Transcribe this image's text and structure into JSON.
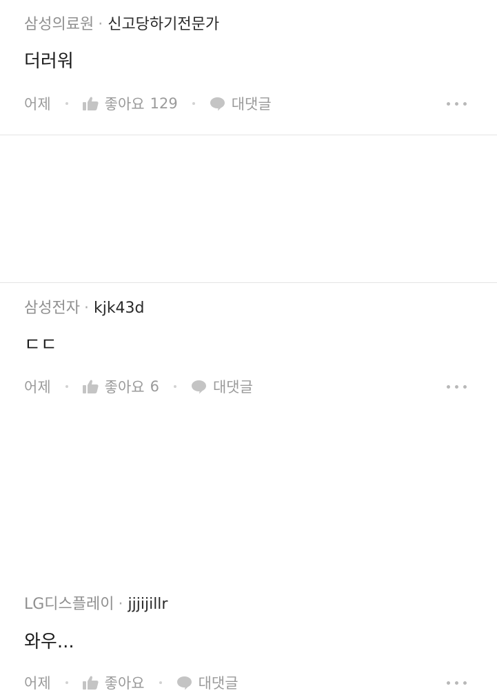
{
  "comments": [
    {
      "affiliation": "삼성의료원",
      "username": "신고당하기전문가",
      "text": "더러워",
      "time": "어제",
      "like_label": "좋아요",
      "like_count": "129",
      "reply_label": "대댓글"
    },
    {
      "affiliation": "삼성전자",
      "username": "kjk43d",
      "text": "ㄷㄷ",
      "time": "어제",
      "like_label": "좋아요",
      "like_count": "6",
      "reply_label": "대댓글"
    },
    {
      "affiliation": "LG디스플레이",
      "username": "jjjijillr",
      "text": "와우...",
      "time": "어제",
      "like_label": "좋아요",
      "like_count": "",
      "reply_label": "대댓글"
    }
  ],
  "separator": "·",
  "icons": {
    "like": "thumbs-up-icon",
    "reply": "speech-bubble-icon",
    "more": "more-dots-icon"
  },
  "colors": {
    "affiliation": "#8f8f8f",
    "username": "#2a2a2a",
    "body_text": "#1a1a1a",
    "action_text": "#9a9a9a",
    "icon": "#c4c4c4",
    "divider": "#e4e4e4"
  }
}
